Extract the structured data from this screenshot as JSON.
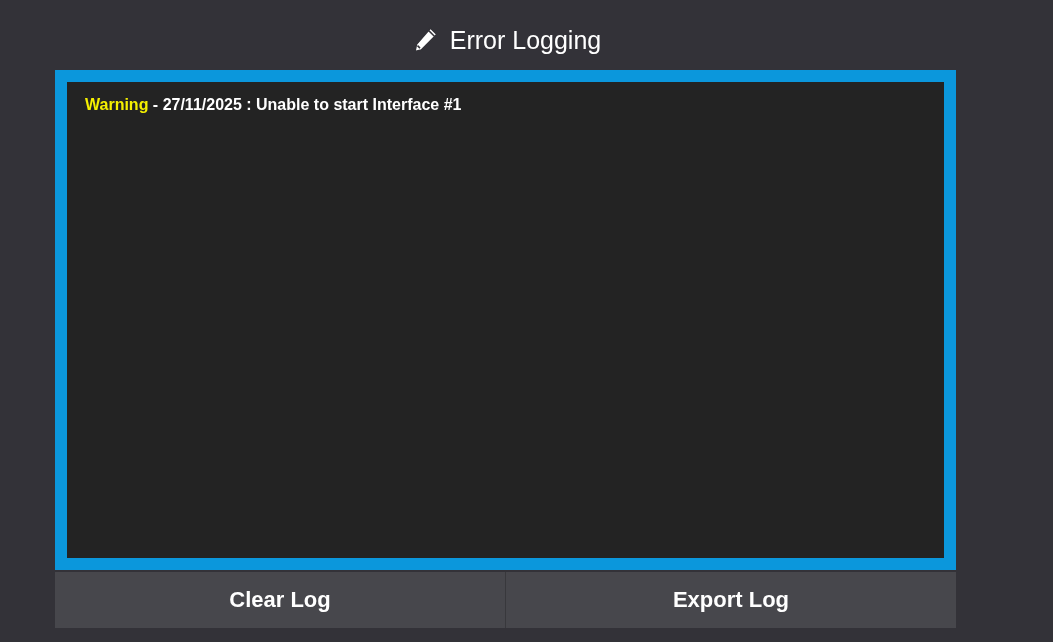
{
  "title": "Error Logging",
  "log": [
    {
      "level": "Warning",
      "color": "#f5f000",
      "message": "- 27/11/2025 : Unable to start Interface #1"
    }
  ],
  "buttons": [
    "Clear Log",
    "Export Log"
  ]
}
